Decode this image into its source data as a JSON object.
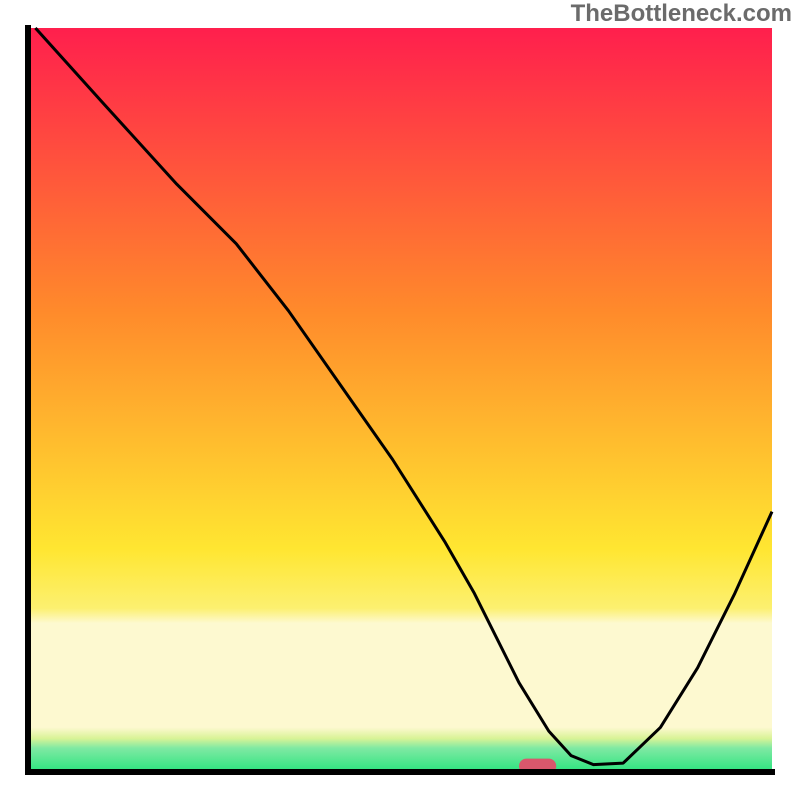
{
  "attribution": "TheBottleneck.com",
  "colors": {
    "gradient_top": "#ff1f4d",
    "gradient_mid_upper": "#ff8a2b",
    "gradient_mid_lower": "#ffe631",
    "pale_band": "#fdf9d0",
    "green_bottom": "#2be47e",
    "green_mid": "#7fe9a3",
    "marker_fill": "#d9576c",
    "curve_stroke": "#000000"
  },
  "chart_data": {
    "type": "line",
    "title": "",
    "xlabel": "",
    "ylabel": "",
    "xlim": [
      0,
      100
    ],
    "ylim": [
      0,
      100
    ],
    "note": "Axes are unlabeled; values are read off in percent of plot area (0 at left/bottom, 100 at right/top). Y≈100 is chart top, Y≈0 is baseline.",
    "series": [
      {
        "name": "bottleneck-curve",
        "x": [
          1,
          10,
          20,
          28,
          35,
          42,
          49,
          56,
          60,
          63,
          66,
          70,
          73,
          76,
          80,
          85,
          90,
          95,
          100
        ],
        "y": [
          100,
          90,
          79,
          71,
          62,
          52,
          42,
          31,
          24,
          18,
          12,
          5.5,
          2.2,
          1,
          1.2,
          6,
          14,
          24,
          35
        ]
      }
    ],
    "marker": {
      "name": "optimal-marker",
      "x_center": 68.5,
      "y_center": 0.8,
      "width": 5.0,
      "height": 2.0
    },
    "background_bands_pct_from_top": {
      "red_to_orange_to_yellow_gradient": [
        0,
        77
      ],
      "pale_yellow_band": [
        77,
        94.5
      ],
      "yellow_green_transition": [
        94.5,
        96.5
      ],
      "green_band": [
        96.5,
        100
      ]
    }
  }
}
